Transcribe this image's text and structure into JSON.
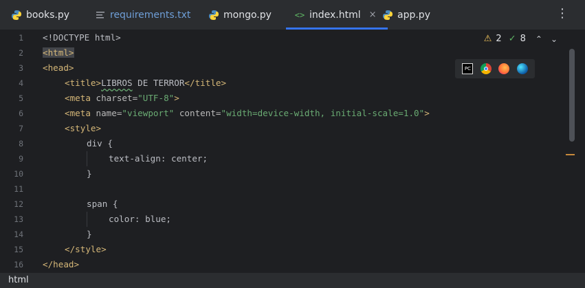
{
  "tabs": [
    {
      "label": "books.py",
      "icon": "python-icon"
    },
    {
      "label": "requirements.txt",
      "icon": "text-file-icon"
    },
    {
      "label": "mongo.py",
      "icon": "python-icon"
    },
    {
      "label": "index.html",
      "icon": "html-icon",
      "active": true,
      "close": "×"
    },
    {
      "label": "app.py",
      "icon": "python-icon"
    }
  ],
  "menu_glyph": "⋮",
  "inspections": {
    "warnings": "2",
    "weak_warnings": "8"
  },
  "browsers": [
    "pycharm-icon",
    "chrome-icon",
    "firefox-icon",
    "edge-icon"
  ],
  "line_numbers": [
    "1",
    "2",
    "3",
    "4",
    "5",
    "6",
    "7",
    "8",
    "9",
    "10",
    "11",
    "12",
    "13",
    "14",
    "15",
    "16"
  ],
  "code": {
    "l1": "<!DOCTYPE html>",
    "l2": "<html>",
    "l3_tag": "<head>",
    "l4_open": "<title>",
    "l4_text": "LIBROS",
    "l4_text2": " DE TERROR",
    "l4_close": "</title>",
    "l5_tag": "<meta",
    "l5_attr": " charset=",
    "l5_str": "\"UTF-8\"",
    "l5_end": ">",
    "l6_tag": "<meta",
    "l6_attr1": " name=",
    "l6_str1": "\"viewport\"",
    "l6_attr2": " content=",
    "l6_str2": "\"width=device-width, initial-scale=1.0\"",
    "l6_end": ">",
    "l7": "<style>",
    "l8": "div {",
    "l9": "text-align: center;",
    "l10": "}",
    "l12": "span {",
    "l13": "color: blue;",
    "l14": "}",
    "l15": "</style>",
    "l16": "</head>"
  },
  "status": {
    "breadcrumb": "html"
  },
  "colors": {
    "accent": "#3574f0",
    "tag": "#d5b778",
    "string": "#6aab73",
    "warning": "#f2c55c"
  }
}
